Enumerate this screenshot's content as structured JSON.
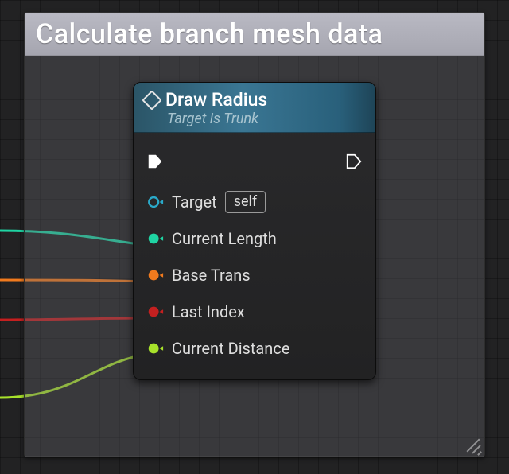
{
  "comment": {
    "title": "Calculate branch mesh data"
  },
  "node": {
    "name": "Draw Radius",
    "subtitle": "Target is Trunk",
    "pins": {
      "target": {
        "label": "Target",
        "default": "self",
        "color": "#2aa9c9"
      },
      "current_length": {
        "label": "Current Length",
        "color": "#1fd4a3"
      },
      "base_trans": {
        "label": "Base Trans",
        "color": "#f07a1e"
      },
      "last_index": {
        "label": "Last Index",
        "color": "#c42020"
      },
      "current_distance": {
        "label": "Current Distance",
        "color": "#a8e22b"
      }
    }
  }
}
